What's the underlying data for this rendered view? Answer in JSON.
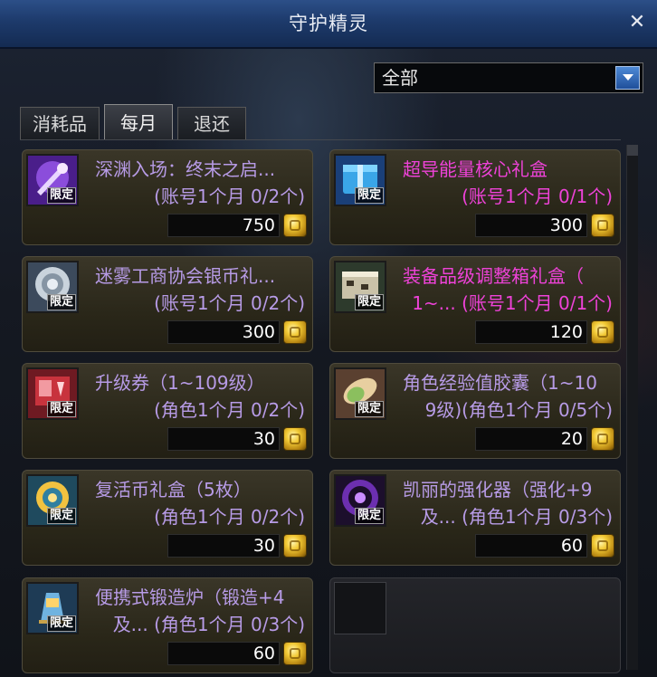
{
  "window": {
    "title": "守护精灵"
  },
  "filter": {
    "selected": "全部"
  },
  "tabs": [
    {
      "label": "消耗品",
      "active": false
    },
    {
      "label": "每月",
      "active": true
    },
    {
      "label": "退还",
      "active": false
    }
  ],
  "badge_label": "限定",
  "items": [
    {
      "name": "深渊入场：终末之启...",
      "sub": "(账号1个月 0/2个)",
      "price": "750",
      "color": "purple",
      "icon": "abyss-ticket-icon"
    },
    {
      "name": "超导能量核心礼盒",
      "sub": "(账号1个月 0/1个)",
      "price": "300",
      "color": "pink",
      "icon": "energy-core-box-icon"
    },
    {
      "name": "迷雾工商协会银币礼...",
      "sub": "(账号1个月 0/2个)",
      "price": "300",
      "color": "purple",
      "icon": "silver-coin-gift-icon"
    },
    {
      "name": "装备品级调整箱礼盒（",
      "sub": "1~... (账号1个月 0/1个)",
      "price": "120",
      "color": "pink",
      "icon": "grade-adjust-box-icon"
    },
    {
      "name": "升级券（1~109级）",
      "sub": "(角色1个月 0/2个)",
      "price": "30",
      "color": "purple",
      "icon": "level-up-ticket-icon"
    },
    {
      "name": "角色经验值胶囊（1~10",
      "sub": "9级)(角色1个月 0/5个)",
      "price": "20",
      "color": "purple",
      "icon": "exp-capsule-icon"
    },
    {
      "name": "复活币礼盒（5枚）",
      "sub": "(角色1个月 0/2个)",
      "price": "30",
      "color": "purple",
      "icon": "revive-coin-box-icon"
    },
    {
      "name": "凯丽的强化器（强化+9",
      "sub": "及... (角色1个月 0/3个)",
      "price": "60",
      "color": "purple",
      "icon": "kelly-enhancer-icon"
    },
    {
      "name": "便携式锻造炉（锻造+4",
      "sub": "及... (角色1个月 0/3个)",
      "price": "60",
      "color": "purple",
      "icon": "portable-forge-icon"
    }
  ],
  "colors": {
    "purple_text": "#b79be6",
    "pink_text": "#ee42d8",
    "title_bar": "#1d3a6b"
  }
}
